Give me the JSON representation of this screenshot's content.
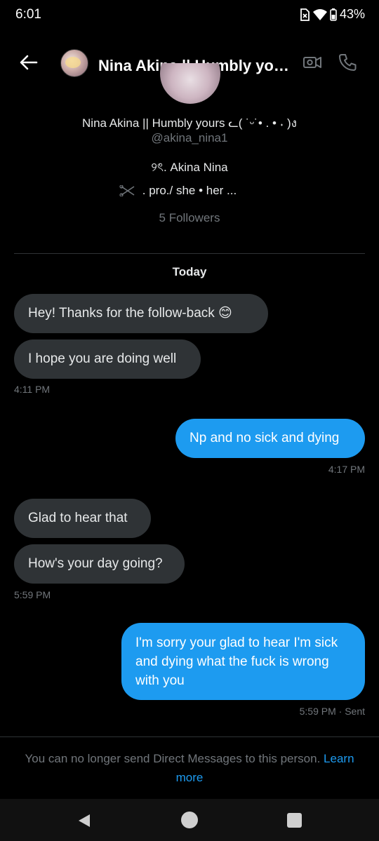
{
  "status_bar": {
    "time": "6:01",
    "battery": "43%"
  },
  "header": {
    "title": "Nina Akina || Humbly yours ᓚ( ˙ᵕ˙• . • ˖ )ง"
  },
  "profile": {
    "name": "Nina Akina || Humbly yours ᓚ( ˙ᵕ˙• . • ˖ )ง",
    "handle": "@akina_nina1",
    "bio_line1": "୨ৎ. Akina Nina",
    "bio_line2": ". pro./   she • her ...",
    "followers": "5 Followers"
  },
  "conversation": {
    "day_label": "Today",
    "messages": [
      {
        "direction": "received",
        "text": "Hey! Thanks for the follow-back 😊"
      },
      {
        "direction": "received",
        "text": "I hope you are doing well"
      },
      {
        "direction": "sent",
        "text": "Np and no sick and dying"
      },
      {
        "direction": "received",
        "text": "Glad to hear that"
      },
      {
        "direction": "received",
        "text": "How's your day going?"
      },
      {
        "direction": "sent",
        "text": "I'm sorry your glad to hear I'm sick and dying what the fuck is wrong with you"
      }
    ],
    "timestamps": [
      "4:11 PM",
      "4:17 PM",
      "5:59 PM",
      "5:59 PM · Sent"
    ]
  },
  "footer": {
    "notice": "You can no longer send Direct Messages to this person.",
    "link": "Learn more"
  },
  "colors": {
    "accent": "#1d9bf0",
    "received_bubble": "#2f3336",
    "background": "#000000",
    "muted": "#71767b"
  },
  "icons": [
    "back-arrow-icon",
    "video-call-icon",
    "phone-icon",
    "wifi-icon",
    "battery-icon",
    "no-sim-icon",
    "nav-back-icon",
    "nav-home-icon",
    "nav-recents-icon",
    "scissors-icon"
  ]
}
